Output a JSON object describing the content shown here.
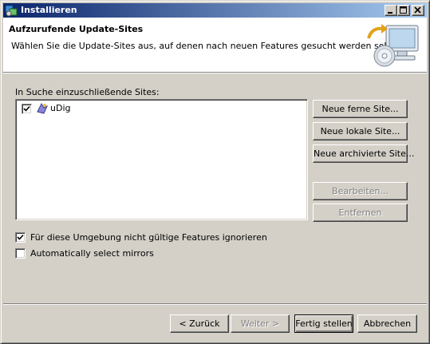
{
  "window": {
    "title": "Installieren",
    "caption_buttons": [
      "minimize-icon",
      "maximize-icon",
      "close-icon"
    ]
  },
  "banner": {
    "title": "Aufzurufende Update-Sites",
    "description": "Wählen Sie die Update-Sites aus, auf denen nach neuen Features gesucht werden soll.",
    "graphic": "install-monitor-cd-icon"
  },
  "sites": {
    "label": "In Suche einzuschließende Sites:",
    "items": [
      {
        "label": "uDig",
        "checked": true,
        "icon": "update-site-icon"
      }
    ]
  },
  "site_buttons": {
    "new_remote": "Neue ferne Site...",
    "new_local": "Neue lokale Site...",
    "new_archived": "Neue archivierte Site...",
    "edit": "Bearbeiten...",
    "remove": "Entfernen"
  },
  "options": {
    "ignore_features": {
      "label": "Für diese Umgebung nicht gültige Features ignorieren",
      "checked": true
    },
    "auto_mirrors": {
      "label": "Automatically select mirrors",
      "checked": false
    }
  },
  "footer": {
    "back": "< Zurück",
    "next": "Weiter >",
    "finish": "Fertig stellen",
    "cancel": "Abbrechen"
  },
  "colors": {
    "titlebar_start": "#0a246a",
    "titlebar_end": "#a6caf0",
    "dialog_background": "#d4d0c8"
  }
}
